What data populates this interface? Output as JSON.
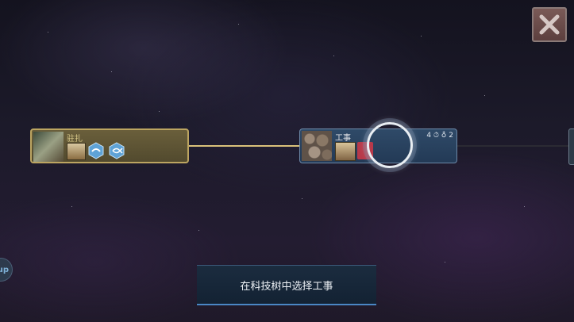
{
  "close_button": {
    "icon": "close-x-icon",
    "color": "#c8b9b6"
  },
  "left_tab": {
    "label": "up"
  },
  "node_unlocked": {
    "title": "驻扎",
    "icons": [
      "building-thumbnail-icon",
      "hex-bird-icon",
      "hex-fish-icon"
    ],
    "color": "#bca561"
  },
  "node_selected": {
    "title": "工事",
    "stats": "4 ⏱ ♁ 2",
    "icons": [
      "wall-thumbnail-icon",
      "red-alarm-icon"
    ],
    "color": "#6d89a8"
  },
  "instruction": {
    "text": "在科技树中选择工事"
  }
}
